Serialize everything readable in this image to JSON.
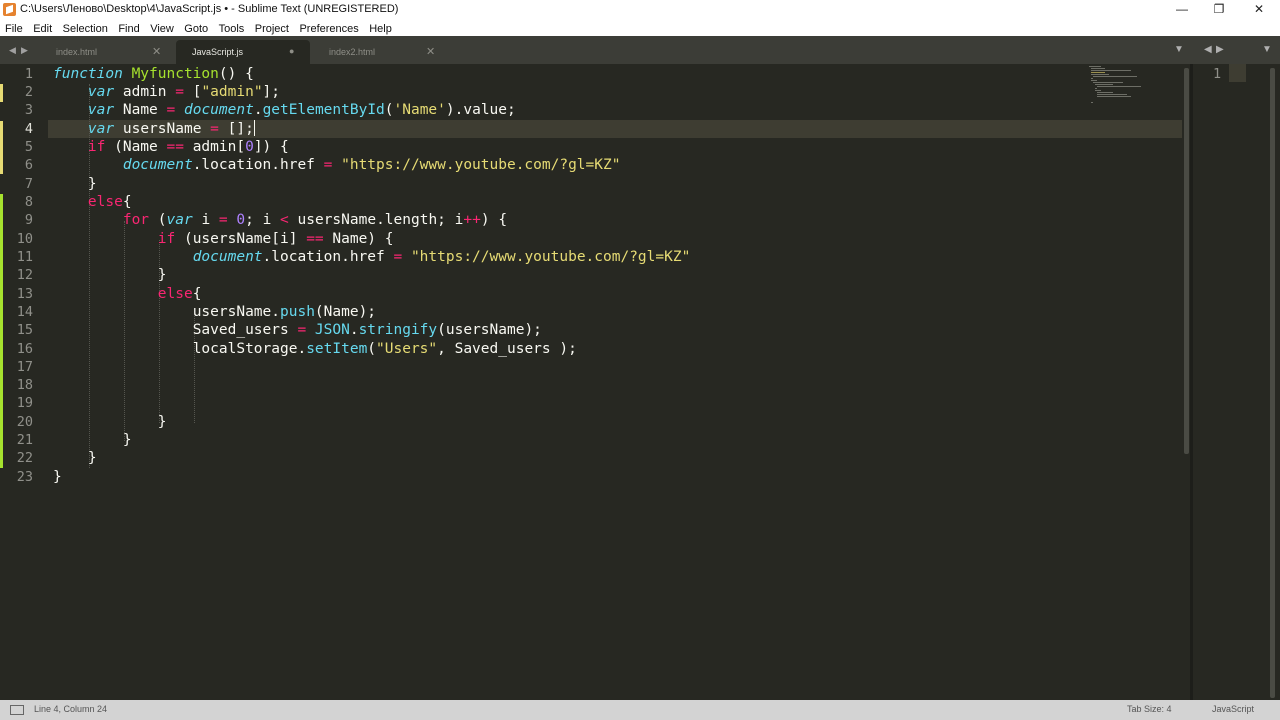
{
  "window": {
    "title": "C:\\Users\\Леново\\Desktop\\4\\JavaScript.js • - Sublime Text (UNREGISTERED)",
    "minimize": "—",
    "maximize": "❐",
    "close": "✕"
  },
  "menu": [
    "File",
    "Edit",
    "Selection",
    "Find",
    "View",
    "Goto",
    "Tools",
    "Project",
    "Preferences",
    "Help"
  ],
  "tabs": [
    {
      "label": "index.html",
      "close": "✕",
      "active": false
    },
    {
      "label": "JavaScript.js",
      "close": "●",
      "active": true
    },
    {
      "label": "index2.html",
      "close": "✕",
      "active": false
    }
  ],
  "nav": {
    "prev": "◀",
    "next": "▶",
    "dropdown": "▼"
  },
  "line_numbers": [
    "1",
    "2",
    "3",
    "4",
    "5",
    "6",
    "7",
    "8",
    "9",
    "10",
    "11",
    "12",
    "13",
    "14",
    "15",
    "16",
    "17",
    "18",
    "19",
    "20",
    "21",
    "22",
    "23"
  ],
  "current_line": 4,
  "code_lines": [
    [
      [
        "st",
        "function"
      ],
      [
        "",
        "&nbsp;"
      ],
      [
        "fn",
        "Myfunction"
      ],
      [
        "",
        "() {"
      ]
    ],
    [
      [
        "",
        "    "
      ],
      [
        "st",
        "var"
      ],
      [
        "",
        ""
      ],
      [
        "",
        ""
      ]
    ],
    [],
    [],
    [],
    [],
    [],
    [],
    [],
    [],
    [],
    [],
    [],
    [],
    [],
    [],
    [],
    [],
    [],
    [],
    [],
    [],
    []
  ],
  "code": {
    "l1": {
      "kw": "function",
      "name": "Myfunction",
      "rest": "() {"
    },
    "l2": {
      "kw": "var",
      "a": " admin ",
      "op": "=",
      "b": " [",
      "s": "\"admin\"",
      "c": "];"
    },
    "l3": {
      "kw": "var",
      "a": " Name ",
      "op": "=",
      "sp": " ",
      "doc": "document",
      "dot": ".",
      "m": "getElementById",
      "p1": "(",
      "s": "'Name'",
      "p2": ").value;"
    },
    "l4": {
      "kw": "var",
      "a": " usersName ",
      "op": "=",
      "b": " [];"
    },
    "l5": {
      "kw": "if",
      "a": " (Name ",
      "op": "==",
      "b": " admin[",
      "n": "0",
      "c": "]) {"
    },
    "l6": {
      "doc": "document",
      "a": ".location.href ",
      "op": "=",
      "sp": " ",
      "s": "\"https://www.youtube.com/?gl=KZ\""
    },
    "l7": {
      "a": "}"
    },
    "l8": {
      "kw": "else",
      "a": "{"
    },
    "l9": {
      "kw": "for",
      "a": " (",
      "v": "var",
      "b": " i ",
      "op": "=",
      "sp": " ",
      "n": "0",
      "c": "; i ",
      "op2": "<",
      "d": " usersName.length; i",
      "op3": "++",
      "e": ") {"
    },
    "l10": {
      "kw": "if",
      "a": " (usersName[i] ",
      "op": "==",
      "b": " Name) {"
    },
    "l11": {
      "doc": "document",
      "a": ".location.href ",
      "op": "=",
      "sp": " ",
      "s": "\"https://www.youtube.com/?gl=KZ\""
    },
    "l12": {
      "a": "}"
    },
    "l13": {
      "kw": "else",
      "a": "{"
    },
    "l14": {
      "a": "usersName.",
      "m": "push",
      "b": "(Name);"
    },
    "l15": {
      "a": "Saved_users ",
      "op": "=",
      "sp": " ",
      "j": "JSON",
      "dot": ".",
      "m": "stringify",
      "b": "(usersName);"
    },
    "l16": {
      "a": "localStorage.",
      "m": "setItem",
      "b": "(",
      "s": "\"Users\"",
      "c": ", Saved_users );"
    },
    "l20": {
      "a": "}"
    },
    "l21": {
      "a": "}"
    },
    "l22": {
      "a": "}"
    },
    "l23": {
      "a": "}"
    }
  },
  "pane2": {
    "line_number": "1"
  },
  "status": {
    "position": "Line 4, Column 24",
    "tab_size": "Tab Size: 4",
    "syntax": "JavaScript"
  },
  "colors": {
    "background": "#272822",
    "keyword": "#f92672",
    "storage": "#66d9ef",
    "function": "#a6e22e",
    "string": "#e6db74",
    "number": "#ae81ff"
  }
}
